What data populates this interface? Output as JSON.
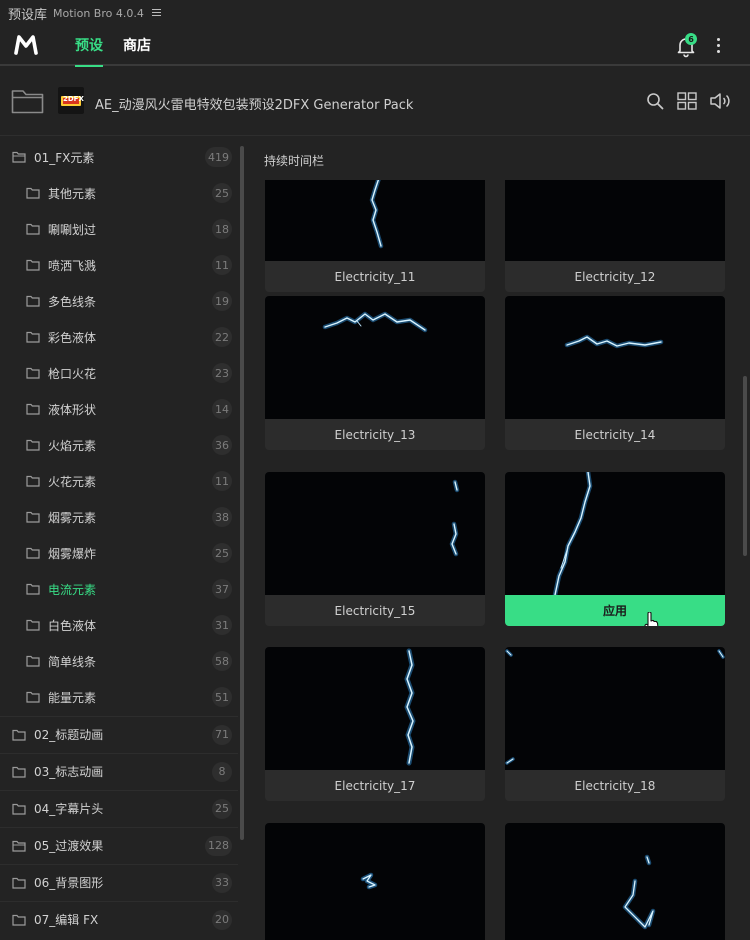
{
  "window": {
    "title": "预设库",
    "app_name": "Motion Bro 4.0.4"
  },
  "nav": {
    "tabs": [
      {
        "label": "预设",
        "active": true
      },
      {
        "label": "商店",
        "active": false
      }
    ],
    "notification_count": "6"
  },
  "pack": {
    "title": "AE_动漫风火雷电特效包装预设2DFX Generator Pack",
    "thumb_logo": "2DFX"
  },
  "colors": {
    "accent": "#38dd86",
    "background": "#232323",
    "card": "#2c2c2c",
    "preview": "#030406",
    "electric": "#6ec6ff"
  },
  "sidebar": {
    "items": [
      {
        "label": "01_FX元素",
        "count": "419",
        "level": "top"
      },
      {
        "label": "其他元素",
        "count": "25",
        "level": "sub"
      },
      {
        "label": "唰唰划过",
        "count": "18",
        "level": "sub"
      },
      {
        "label": "喷洒飞溅",
        "count": "11",
        "level": "sub"
      },
      {
        "label": "多色线条",
        "count": "19",
        "level": "sub"
      },
      {
        "label": "彩色液体",
        "count": "22",
        "level": "sub"
      },
      {
        "label": "枪口火花",
        "count": "23",
        "level": "sub"
      },
      {
        "label": "液体形状",
        "count": "14",
        "level": "sub"
      },
      {
        "label": "火焰元素",
        "count": "36",
        "level": "sub"
      },
      {
        "label": "火花元素",
        "count": "11",
        "level": "sub"
      },
      {
        "label": "烟雾元素",
        "count": "38",
        "level": "sub"
      },
      {
        "label": "烟雾爆炸",
        "count": "25",
        "level": "sub"
      },
      {
        "label": "电流元素",
        "count": "37",
        "level": "sub",
        "active": true
      },
      {
        "label": "白色液体",
        "count": "31",
        "level": "sub"
      },
      {
        "label": "简单线条",
        "count": "58",
        "level": "sub"
      },
      {
        "label": "能量元素",
        "count": "51",
        "level": "sub"
      },
      {
        "label": "02_标题动画",
        "count": "71",
        "level": "top"
      },
      {
        "label": "03_标志动画",
        "count": "8",
        "level": "top"
      },
      {
        "label": "04_字幕片头",
        "count": "25",
        "level": "top"
      },
      {
        "label": "05_过渡效果",
        "count": "128",
        "level": "top"
      },
      {
        "label": "06_背景图形",
        "count": "33",
        "level": "top"
      },
      {
        "label": "07_编辑 FX",
        "count": "20",
        "level": "top"
      }
    ]
  },
  "content": {
    "section_title": "持续时间栏",
    "cards": [
      {
        "label": "Electricity_11"
      },
      {
        "label": "Electricity_12"
      },
      {
        "label": "Electricity_13"
      },
      {
        "label": "Electricity_14"
      },
      {
        "label": "Electricity_15"
      },
      {
        "label": "应用",
        "hover": true
      },
      {
        "label": "Electricity_17"
      },
      {
        "label": "Electricity_18"
      },
      {
        "label": ""
      },
      {
        "label": ""
      }
    ]
  },
  "icons": {
    "logo": "motion-bro-logo",
    "menu": "hamburger-icon",
    "bell": "bell-icon",
    "more": "kebab-icon",
    "folder": "folder-icon",
    "search": "search-icon",
    "grid": "grid-view-icon",
    "sound": "speaker-icon"
  }
}
